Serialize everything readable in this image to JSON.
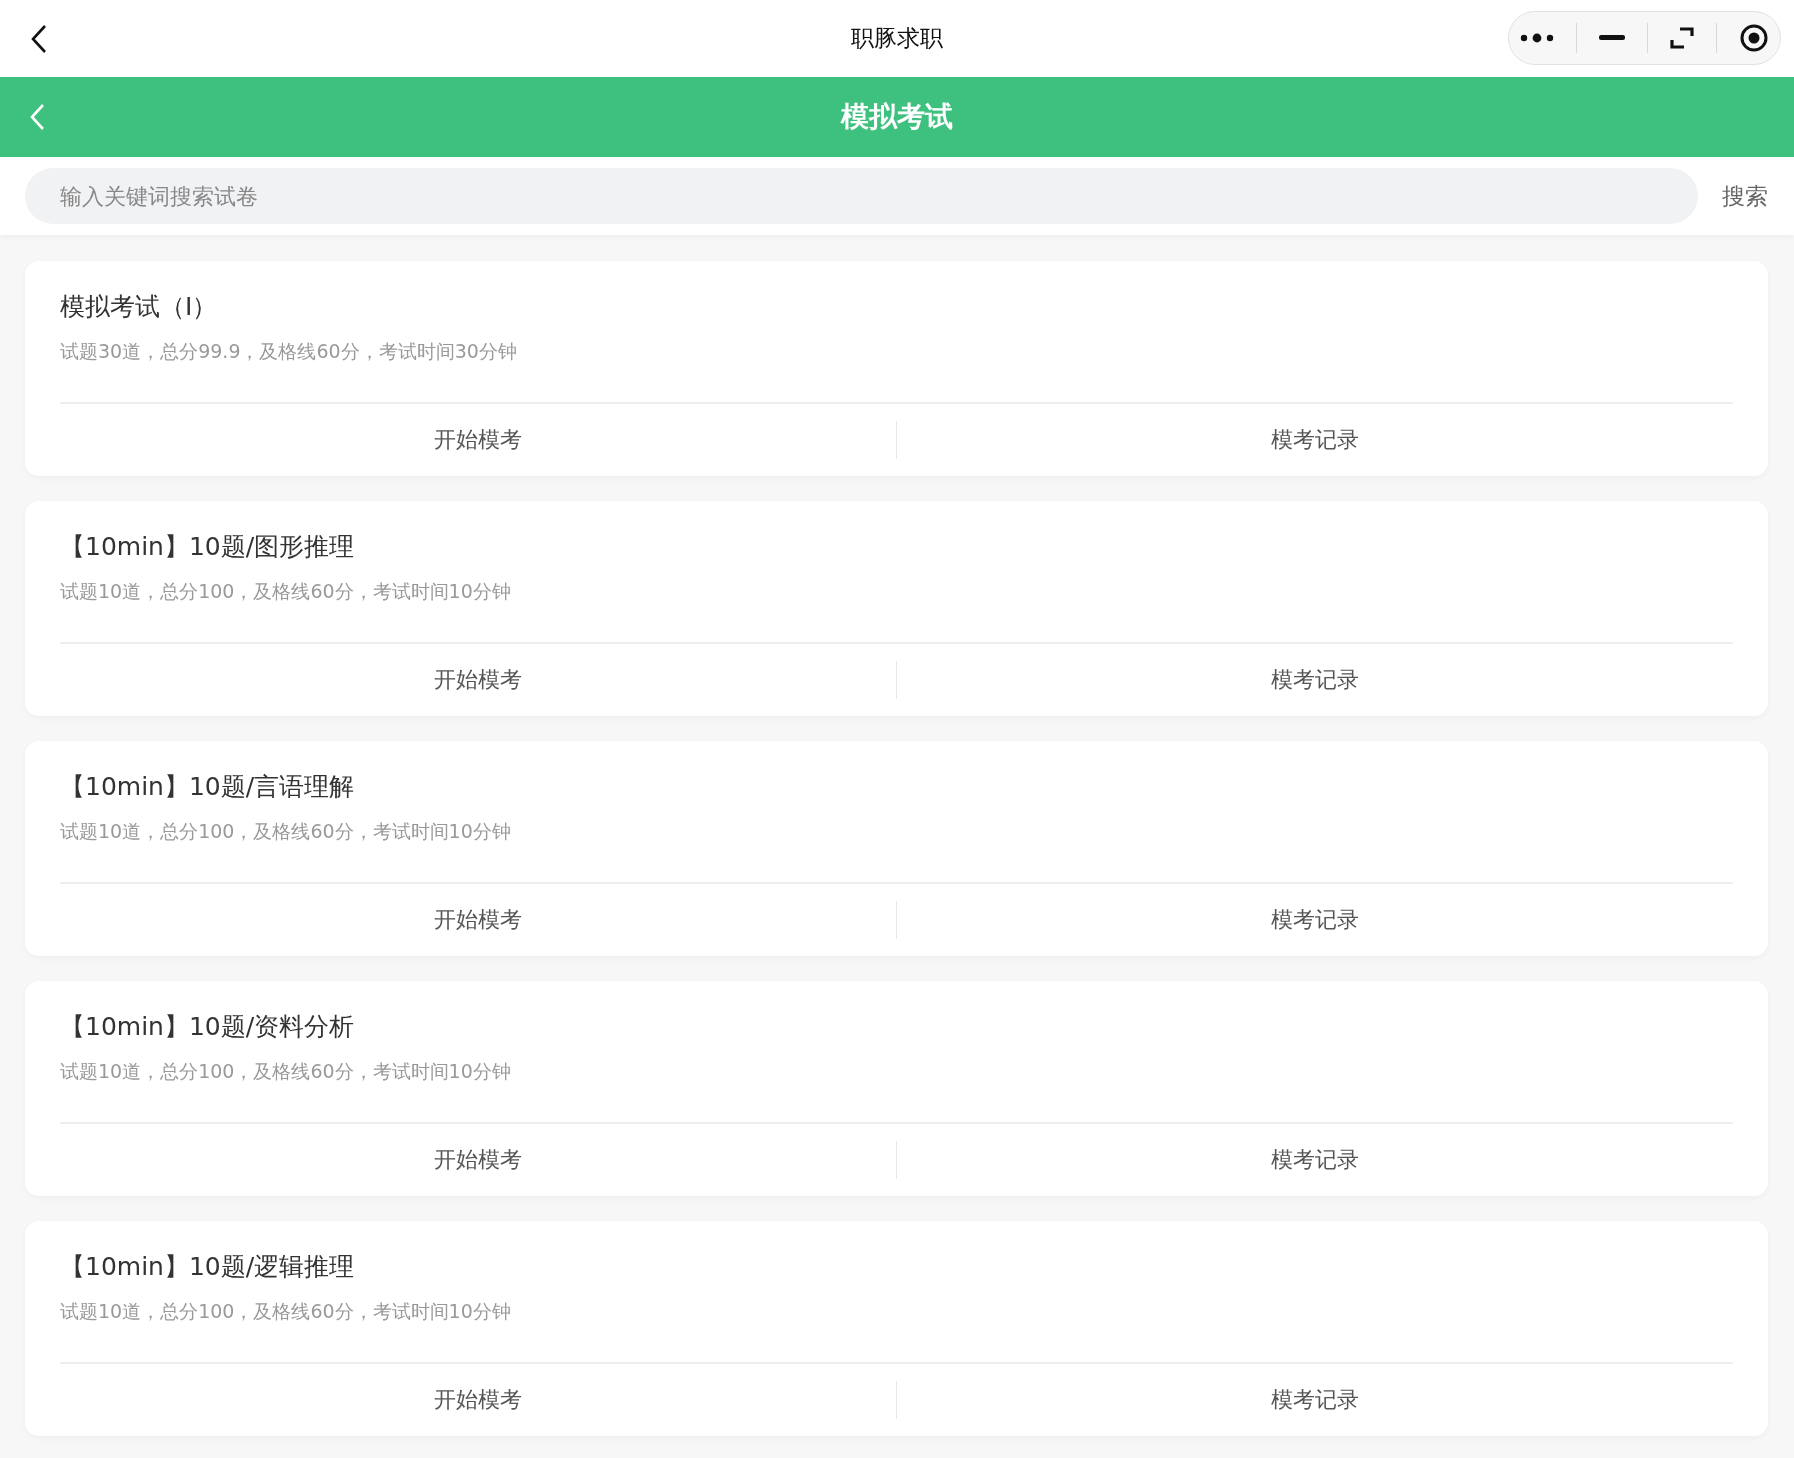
{
  "top_bar": {
    "title": "职豚求职"
  },
  "header": {
    "title": "模拟考试"
  },
  "search": {
    "placeholder": "输入关键词搜索试卷",
    "button": "搜索"
  },
  "exams": [
    {
      "title": "模拟考试（I）",
      "info": "试题30道，总分99.9，及格线60分，考试时间30分钟",
      "actions": [
        "开始模考",
        "模考记录"
      ]
    },
    {
      "title": "【10min】10题/图形推理",
      "info": "试题10道，总分100，及格线60分，考试时间10分钟",
      "actions": [
        "开始模考",
        "模考记录"
      ]
    },
    {
      "title": "【10min】10题/言语理解",
      "info": "试题10道，总分100，及格线60分，考试时间10分钟",
      "actions": [
        "开始模考",
        "模考记录"
      ]
    },
    {
      "title": "【10min】10题/资料分析",
      "info": "试题10道，总分100，及格线60分，考试时间10分钟",
      "actions": [
        "开始模考",
        "模考记录"
      ]
    },
    {
      "title": "【10min】10题/逻辑推理",
      "info": "试题10道，总分100，及格线60分，考试时间10分钟",
      "actions": [
        "开始模考",
        "模考记录"
      ]
    }
  ]
}
